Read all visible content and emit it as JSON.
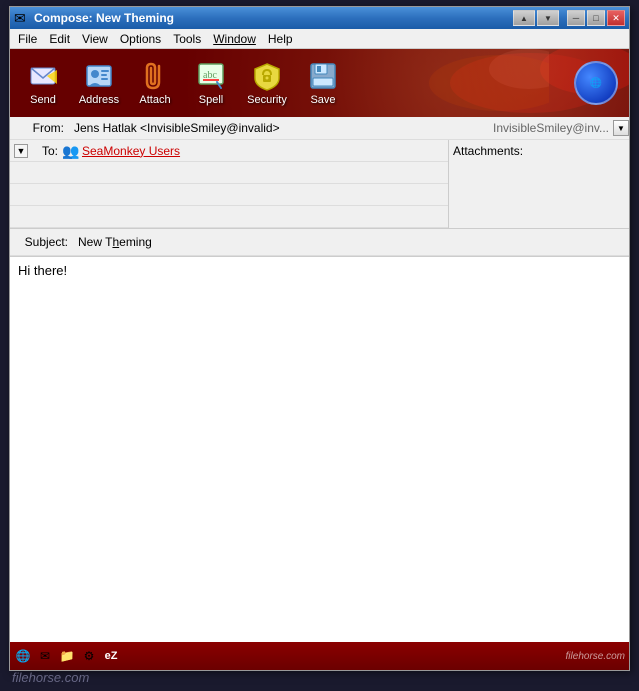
{
  "window": {
    "title": "Compose: New Theming",
    "icon": "✉"
  },
  "titlebar": {
    "minimize_label": "─",
    "restore_label": "□",
    "close_label": "✕"
  },
  "menubar": {
    "items": [
      {
        "id": "file",
        "label": "File"
      },
      {
        "id": "edit",
        "label": "Edit"
      },
      {
        "id": "view",
        "label": "View"
      },
      {
        "id": "options",
        "label": "Options"
      },
      {
        "id": "tools",
        "label": "Tools"
      },
      {
        "id": "window",
        "label": "Window"
      },
      {
        "id": "help",
        "label": "Help"
      }
    ]
  },
  "toolbar": {
    "buttons": [
      {
        "id": "send",
        "label": "Send",
        "icon": "📤"
      },
      {
        "id": "address",
        "label": "Address",
        "icon": "👤"
      },
      {
        "id": "attach",
        "label": "Attach",
        "icon": "📎"
      },
      {
        "id": "spell",
        "label": "Spell",
        "icon": "🔤"
      },
      {
        "id": "security",
        "label": "Security",
        "icon": "🔒"
      },
      {
        "id": "save",
        "label": "Save",
        "icon": "💾"
      }
    ]
  },
  "header": {
    "from_label": "From:",
    "from_value": "Jens Hatlak <InvisibleSmiley@invalid>",
    "from_ghost": "InvisibleSmiley@inv...",
    "to_label": "To:",
    "to_expand": "▼",
    "recipient": "SeaMonkey Users",
    "empty_rows": 3,
    "subject_label": "Subject:",
    "subject_value": "New Theming",
    "attachments_label": "Attachments:"
  },
  "body": {
    "text": "Hi there!"
  },
  "statusbar": {
    "icons": [
      "🌐",
      "✉",
      "📁",
      "⚙",
      "eZ"
    ]
  },
  "watermark": {
    "text": "filehorse.com"
  }
}
